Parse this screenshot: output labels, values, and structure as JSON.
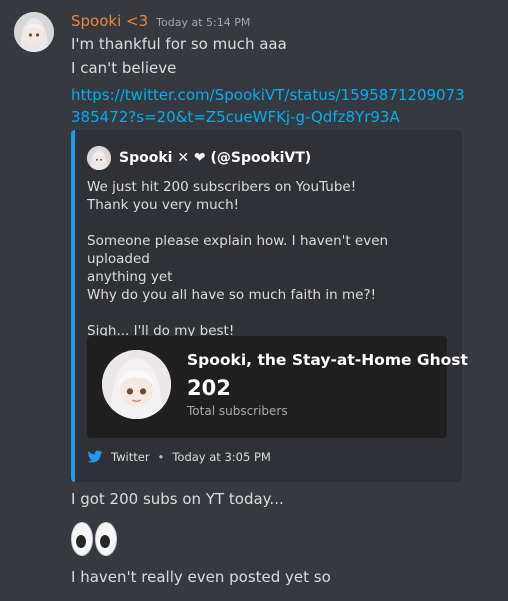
{
  "message": {
    "author": "Spooki <3",
    "timestamp": "Today at 5:14 PM",
    "lines": {
      "line1": "I'm thankful for so much aaa",
      "line2": "I can't believe"
    },
    "link": "https://twitter.com/SpookiVT/status/1595871209073385472?s=20&t=Z5cueWFKj-g-Qdfz8Yr93A",
    "after_embed": {
      "line1": "I got 200 subs on YT today...",
      "line2": "I haven't really even posted yet so"
    },
    "emoji": "eyes-emoji"
  },
  "embed": {
    "accent_color": "#1d9bf0",
    "author": "Spooki ✕ ❤ (@SpookiVT)",
    "description": {
      "p1_l1": "We just hit 200 subscribers on YouTube!",
      "p1_l2": "Thank you very much!",
      "p2_l1": "Someone please explain how. I haven't even uploaded",
      "p2_l2": "anything yet",
      "p2_l3": "Why do you all have so much faith in me?!",
      "p3_l1": "Sigh... I'll do my best!"
    },
    "card": {
      "title": "Spooki, the Stay-at-Home Ghost",
      "count": "202",
      "subtext": "Total subscribers"
    },
    "footer": {
      "source": "Twitter",
      "separator": "•",
      "time": "Today at 3:05 PM",
      "icon": "twitter-bird-icon"
    }
  }
}
